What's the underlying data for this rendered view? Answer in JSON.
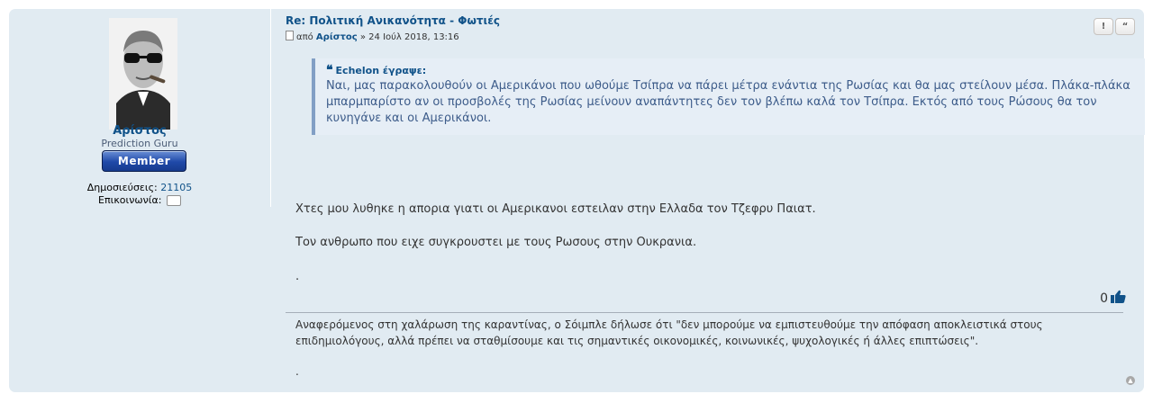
{
  "profile": {
    "username": "Αρίστος",
    "rank_title": "Prediction Guru",
    "rank_badge": "Member",
    "posts_label": "Δημοσιεύσεις:",
    "posts_count": "21105",
    "contact_label": "Επικοινωνία:"
  },
  "post": {
    "title": "Re: Πολιτική Ανικανότητα - Φωτιές",
    "meta_by": "από",
    "author": "Αρίστος",
    "date": "» 24 Ιούλ 2018, 13:16",
    "report_btn": "!",
    "quote_btn": "“",
    "quote": {
      "cite": "Echelon έγραψε:",
      "text": "Ναι, μας παρακολουθούν οι Αμερικάνοι που ωθούμε Τσίπρα να πάρει μέτρα ενάντια της Ρωσίας και θα μας στείλουν μέσα. Πλάκα-πλάκα μπαρμπαρίστο αν οι προσβολές της Ρωσίας μείνουν αναπάντητες δεν τον βλέπω καλά τον Τσίπρα. Εκτός από τους Ρώσους θα τον κυνηγάνε και οι Αμερικάνοι."
    },
    "paragraph1": "Χτες μου λυθηκε η απορια γιατι οι Αμερικανοι εστειλαν στην Ελλαδα τον Τζεφρυ Παιατ.",
    "paragraph2": "Τον ανθρωπο που ειχε συγκρουστει με τους Ρωσους στην Ουκρανια.",
    "paragraph3": ".",
    "like_count": "0"
  },
  "signature": {
    "text": "Αναφερόμενος στη χαλάρωση της καραντίνας, ο Σόιμπλε δήλωσε ότι \"δεν μπορούμε να εμπιστευθούμε την απόφαση αποκλειστικά στους επιδημιολόγους, αλλά πρέπει να σταθμίσουμε και τις σημαντικές οικονομικές, κοινωνικές, ψυχολογικές ή άλλες επιπτώσεις\".",
    "dot": "."
  },
  "colors": {
    "post_bg": "#e1ebf2",
    "link": "#105289",
    "quote_border": "#829fc5",
    "badge": "#1f49a8"
  },
  "icons": [
    "post-icon",
    "contact-icon",
    "thumbs-up-icon",
    "back-to-top-icon"
  ]
}
